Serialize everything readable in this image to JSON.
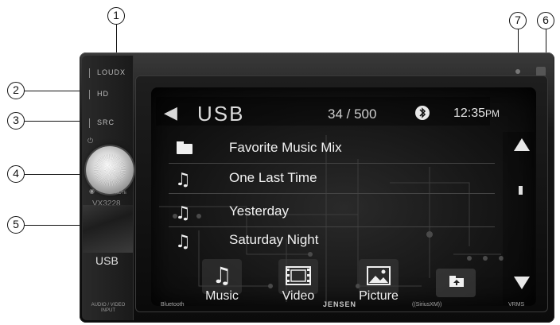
{
  "callouts": [
    "1",
    "2",
    "3",
    "4",
    "5",
    "6",
    "7"
  ],
  "side_panel": {
    "buttons": [
      "LOUDX",
      "HD",
      "SRC"
    ],
    "knob_label": "MUTE",
    "model": "VX3228",
    "usb_label": "USB",
    "input_label": "AUDIO / VIDEO\nINPUT"
  },
  "screen": {
    "source_title": "USB",
    "track_count": "34 / 500",
    "clock_time": "12:35",
    "clock_ampm": "PM",
    "list": [
      {
        "icon": "folder-icon",
        "label": "Favorite Music Mix"
      },
      {
        "icon": "music-note-icon",
        "label": "One Last Time"
      },
      {
        "icon": "music-note-icon",
        "label": "Yesterday"
      },
      {
        "icon": "music-note-icon",
        "label": "Saturday Night"
      }
    ],
    "tabs": [
      "Music",
      "Video",
      "Picture"
    ]
  },
  "bottom_logos": [
    "Bluetooth",
    "JENSEN",
    "((SiriusXM))",
    "VRMS"
  ],
  "colors": {
    "text": "#f0f0f0",
    "bezel": "#111111"
  }
}
